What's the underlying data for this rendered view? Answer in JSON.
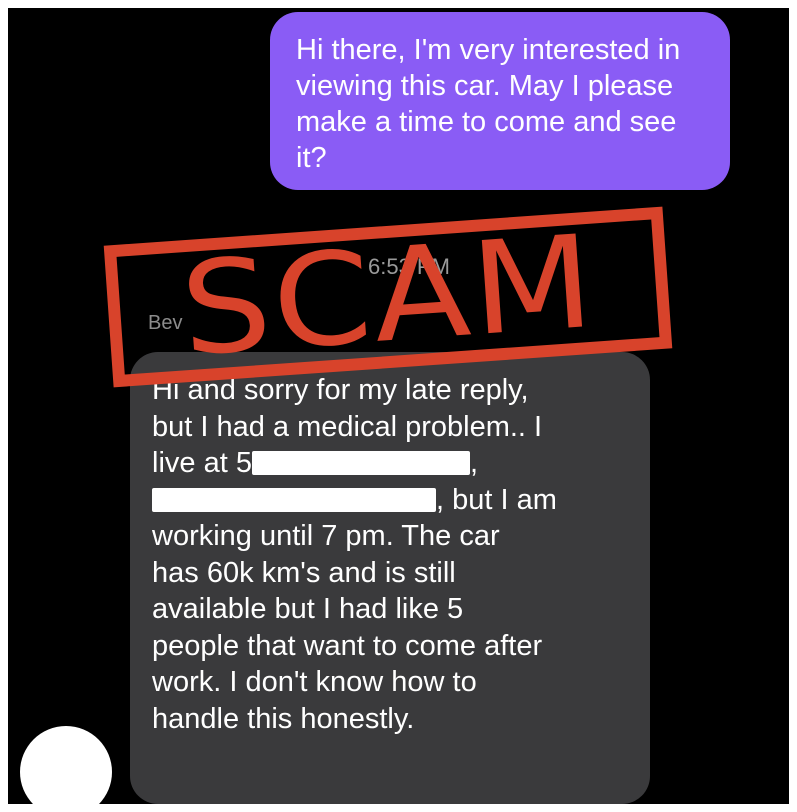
{
  "outgoing_message": {
    "text": "Hi there, I'm very interested in viewing this car. May I please make a time to come and see it?"
  },
  "timestamp": "6:53 PM",
  "incoming_message": {
    "sender": "Bev",
    "line_1": "Hi and sorry for my late reply,",
    "line_2": "but I had a medical problem.. I",
    "line_3_prefix": "live at 5",
    "line_3_suffix": ",",
    "line_4_suffix": ", but I am",
    "line_5": "working until 7 pm. The car",
    "line_6": "has 60k km's and is still",
    "line_7": "available but I had like 5",
    "line_8": "people that want to come after",
    "line_9": "work. I don't know how to",
    "line_10": "handle this honestly."
  },
  "stamp": {
    "label": "SCAM",
    "color": "#d8432b"
  },
  "colors": {
    "outgoing_bubble": "#8a5cf5",
    "incoming_bubble": "#3a3a3c",
    "background": "#000000"
  }
}
